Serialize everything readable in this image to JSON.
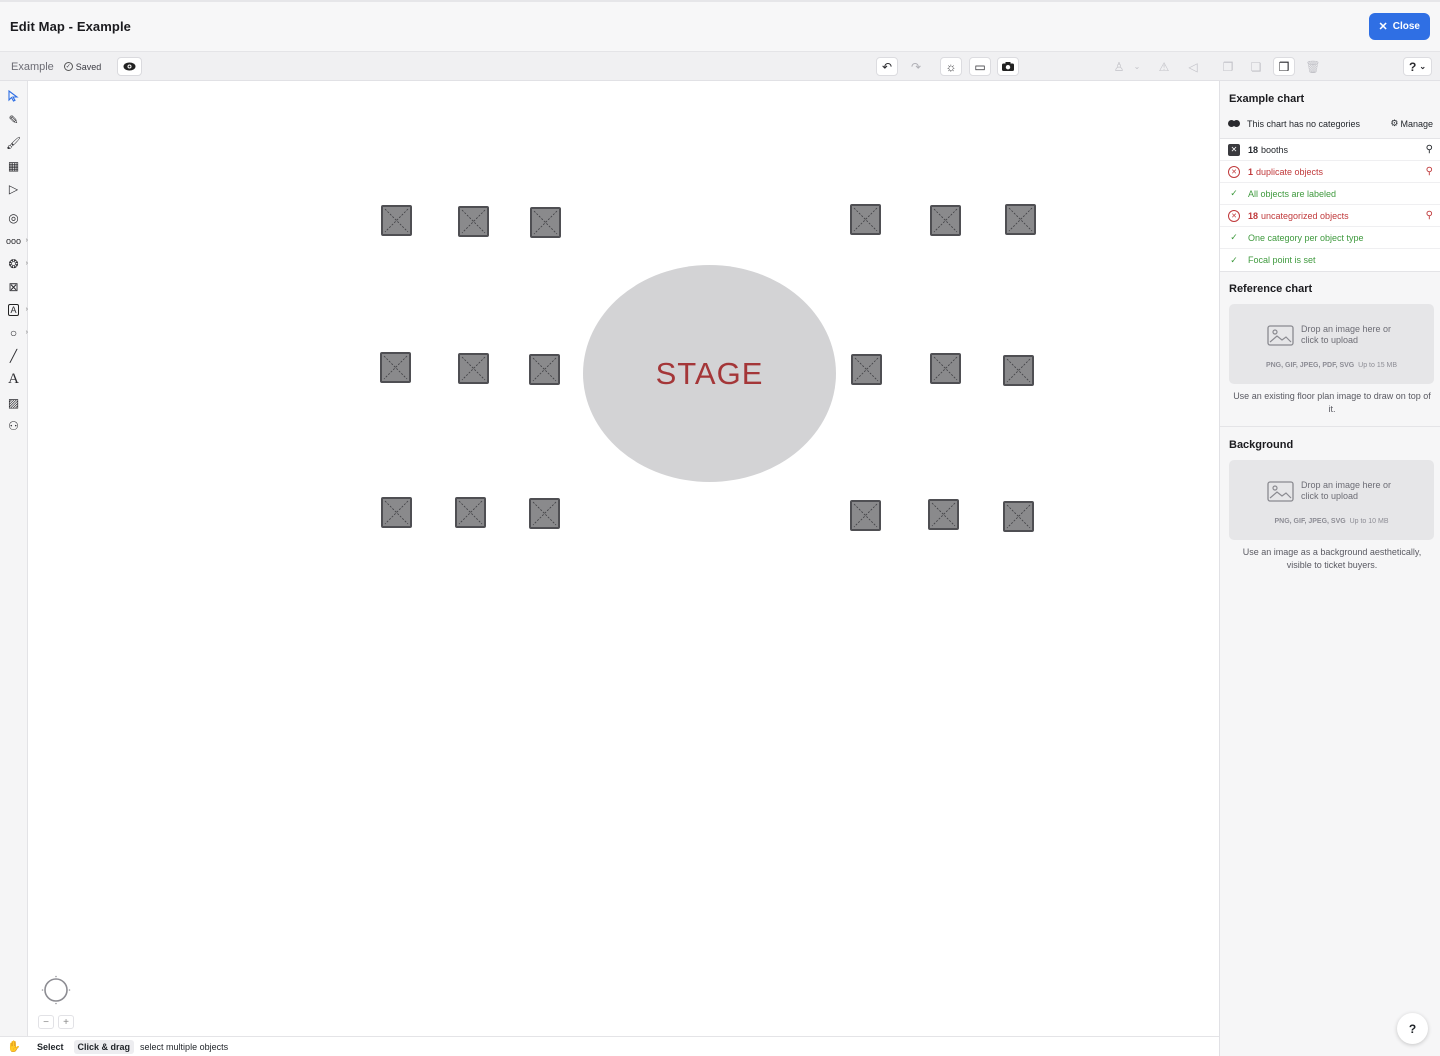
{
  "window": {
    "title": "Edit Map - Example",
    "close_label": "Close"
  },
  "toolbar": {
    "chart_name": "Example",
    "saved_label": "Saved",
    "help_label": "?"
  },
  "tools": [
    "select-arrow",
    "node-edit",
    "brush",
    "booth-grid",
    "focal-select",
    "focal-point",
    "row",
    "table",
    "booth",
    "text-area",
    "shape-circle",
    "line",
    "text",
    "image",
    "restrooms"
  ],
  "canvas": {
    "stage_label": "STAGE",
    "booth_count_visible": 18,
    "zoom_in": "+",
    "zoom_out": "−"
  },
  "status": {
    "mode": "Select",
    "key": "Click & drag",
    "hint": "select multiple objects"
  },
  "panel": {
    "chart_title": "Example chart",
    "categories_text": "This chart has no categories",
    "manage_label": "Manage",
    "checks": [
      {
        "num": "18",
        "text": "booths",
        "state": "neutral",
        "searchable": true
      },
      {
        "num": "1",
        "text": "duplicate objects",
        "state": "error",
        "searchable": true
      },
      {
        "num": "",
        "text": "All objects are labeled",
        "state": "ok",
        "searchable": false
      },
      {
        "num": "18",
        "text": "uncategorized objects",
        "state": "error",
        "searchable": true
      },
      {
        "num": "",
        "text": "One category per object type",
        "state": "ok",
        "searchable": false
      },
      {
        "num": "",
        "text": "Focal point is set",
        "state": "ok",
        "searchable": false
      }
    ],
    "reference": {
      "title": "Reference chart",
      "drop_text": "Drop an image here or click to upload",
      "types": "PNG, GIF, JPEG, PDF, SVG",
      "limit": "Up to 15 MB",
      "note": "Use an existing floor plan image to draw on top of it."
    },
    "background": {
      "title": "Background",
      "drop_text": "Drop an image here or click to upload",
      "types": "PNG, GIF, JPEG, SVG",
      "limit": "Up to 10 MB",
      "note": "Use an image as a background aesthetically, visible to ticket buyers."
    },
    "help_label": "?"
  },
  "colors": {
    "accent": "#2f6fe4",
    "ok": "#3f9a3e",
    "error": "#c0393b",
    "stage_text": "#a43638"
  }
}
